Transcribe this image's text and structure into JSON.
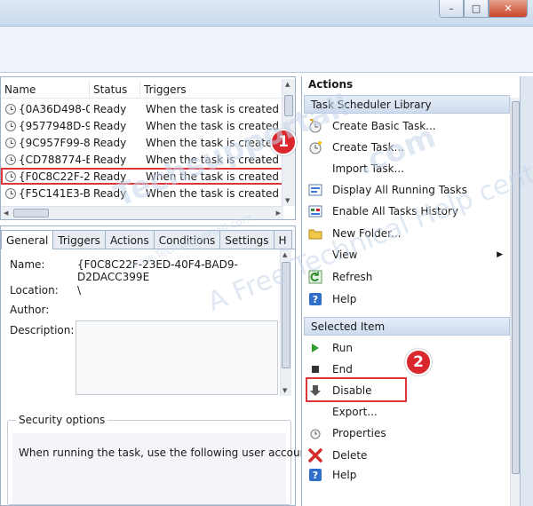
{
  "window": {
    "minimize": "–",
    "maximize": "□",
    "close": "✕"
  },
  "tasklist": {
    "columns": [
      "Name",
      "Status",
      "Triggers"
    ],
    "rows": [
      {
        "name": "{0A36D498-0...",
        "status": "Ready",
        "trigger": "When the task is created or m"
      },
      {
        "name": "{9577948D-9...",
        "status": "Ready",
        "trigger": "When the task is created or m"
      },
      {
        "name": "{9C957F99-8...",
        "status": "Ready",
        "trigger": "When the task is created or m"
      },
      {
        "name": "{CD788774-E...",
        "status": "Ready",
        "trigger": "When the task is created or m"
      },
      {
        "name": "{F0C8C22F-2...",
        "status": "Ready",
        "trigger": "When the task is created or m"
      },
      {
        "name": "{F5C141E3-B...",
        "status": "Ready",
        "trigger": "When the task is created or m"
      }
    ]
  },
  "details": {
    "tabs": [
      "General",
      "Triggers",
      "Actions",
      "Conditions",
      "Settings",
      "H"
    ],
    "name_label": "Name:",
    "name_value": "{F0C8C22F-23ED-40F4-BAD9-D2DACC399E",
    "location_label": "Location:",
    "location_value": "\\",
    "author_label": "Author:",
    "description_label": "Description:",
    "security_legend": "Security options",
    "security_text": "When running the task, use the following user account:"
  },
  "actions": {
    "header": "Actions",
    "library_section": "Task Scheduler Library",
    "library_items": [
      {
        "label": "Create Basic Task...",
        "icon": "create-basic-task-icon"
      },
      {
        "label": "Create Task...",
        "icon": "create-task-icon"
      },
      {
        "label": "Import Task...",
        "icon": ""
      },
      {
        "label": "Display All Running Tasks",
        "icon": "running-tasks-icon"
      },
      {
        "label": "Enable All Tasks History",
        "icon": "history-icon"
      },
      {
        "label": "New Folder...",
        "icon": "folder-icon"
      },
      {
        "label": "View",
        "icon": ""
      },
      {
        "label": "Refresh",
        "icon": "refresh-icon"
      },
      {
        "label": "Help",
        "icon": "help-icon"
      }
    ],
    "selected_section": "Selected Item",
    "selected_items": [
      {
        "label": "Run",
        "icon": "run-icon"
      },
      {
        "label": "End",
        "icon": "end-icon"
      },
      {
        "label": "Disable",
        "icon": "disable-icon"
      },
      {
        "label": "Export...",
        "icon": ""
      },
      {
        "label": "Properties",
        "icon": "properties-icon"
      },
      {
        "label": "Delete",
        "icon": "delete-icon"
      },
      {
        "label": "Help",
        "icon": "help-icon"
      }
    ]
  },
  "callouts": {
    "step1": "1",
    "step2": "2"
  },
  "watermark": {
    "brand1": "Techsupportall",
    "brand2": ".com",
    "tagline": "A Free Technical Help center",
    "url": "www.Techsupportall.com"
  },
  "colors": {
    "highlight": "#e0343b",
    "section": "#cfdcee",
    "badge": "#d9272d"
  }
}
